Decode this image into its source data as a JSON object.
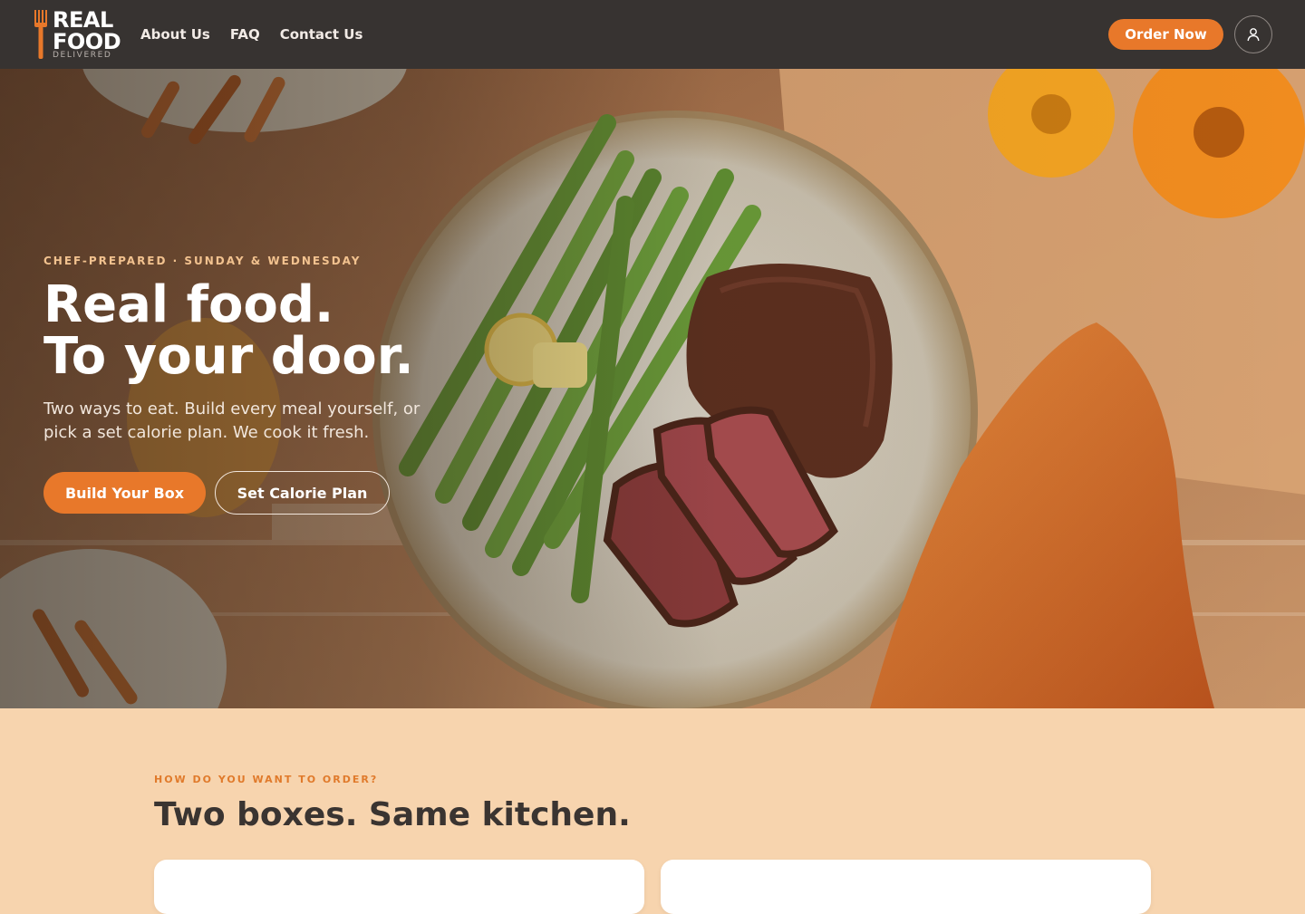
{
  "brand": {
    "line1": "REAL",
    "line2": "FOOD",
    "tagline": "DELIVERED",
    "accent": "#e8782a",
    "nav_bg": "#373331"
  },
  "nav": {
    "links": [
      "About Us",
      "FAQ",
      "Contact Us"
    ],
    "order_label": "Order Now",
    "account_icon": "user-icon"
  },
  "hero": {
    "eyebrow": "CHEF-PREPARED · SUNDAY & WEDNESDAY",
    "headline_line1": "Real food.",
    "headline_line2": "To your door.",
    "subtext": "Two ways to eat. Build every meal yourself, or pick a set calorie plan. We cook it fresh.",
    "primary_cta": "Build Your Box",
    "secondary_cta": "Set Calorie Plan"
  },
  "order_section": {
    "eyebrow": "HOW DO YOU WANT TO ORDER?",
    "title": "Two boxes. Same kitchen.",
    "bg": "#f7d4ae"
  }
}
